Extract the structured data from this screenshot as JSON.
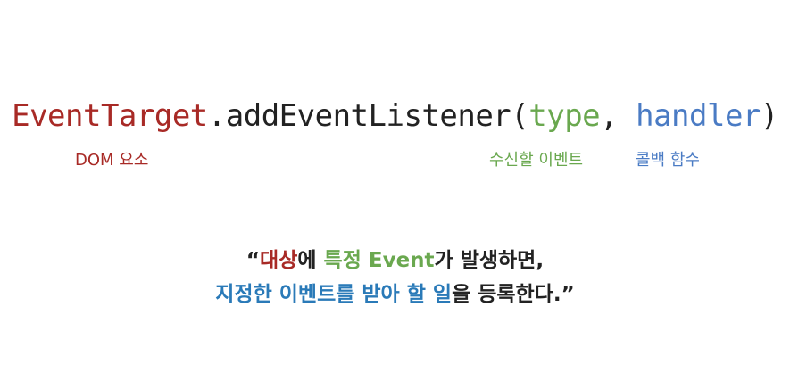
{
  "colors": {
    "target_red": "#a82a26",
    "type_green": "#6aa84f",
    "handler_blue": "#4a7bc4",
    "action_blue": "#2a7ab8",
    "text_dark": "#222222"
  },
  "code": {
    "target": "EventTarget",
    "method": ".addEventListener(",
    "type_param": "type",
    "separator": ", ",
    "handler_param": "handler",
    "close": ")"
  },
  "labels": {
    "target": "DOM 요소",
    "type": "수신할 이벤트",
    "handler": "콜백 함수"
  },
  "quote": {
    "line1": {
      "open": "“",
      "subject": "대상",
      "particle1": "에 ",
      "event_specific": "특정 Event",
      "rest": "가 발생하면,"
    },
    "line2": {
      "action": "지정한 이벤트를 받아 할 일",
      "rest": "을 등록한다.”"
    }
  }
}
